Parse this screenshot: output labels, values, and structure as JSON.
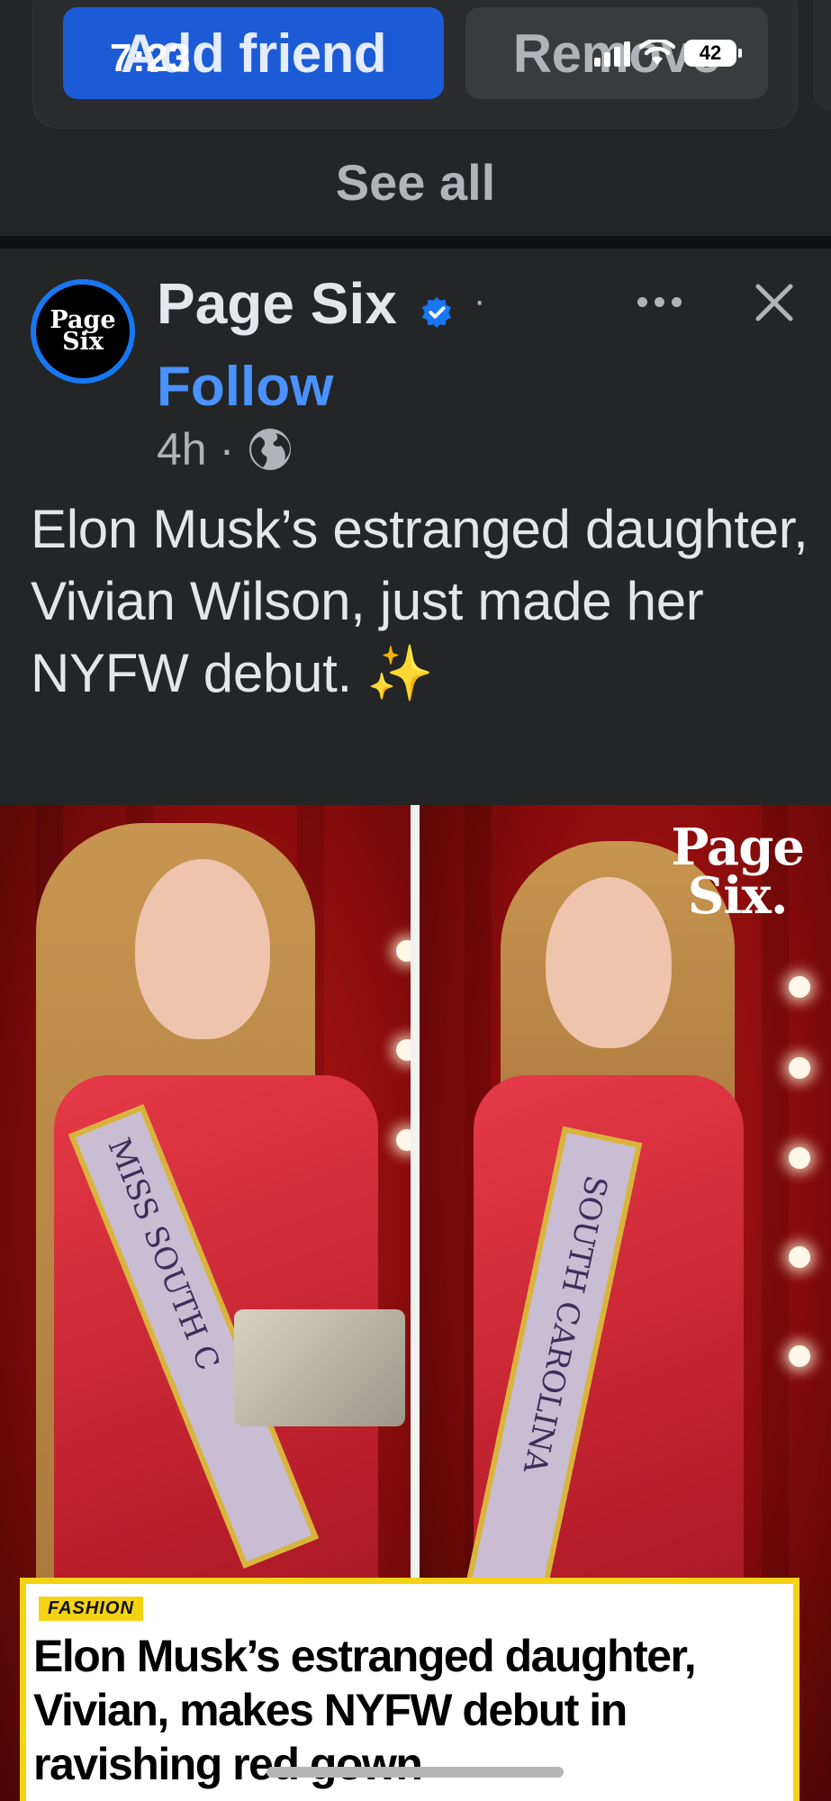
{
  "status_bar": {
    "time": "7:23",
    "battery": "42"
  },
  "suggestion_card": {
    "add_friend_label": "Add friend",
    "remove_label": "Remove",
    "see_all_label": "See all"
  },
  "post": {
    "page_name": "Page Six",
    "avatar_text_line1": "Page",
    "avatar_text_line2": "Six",
    "separator": "·",
    "follow_label": "Follow",
    "time_ago": "4h",
    "meta_separator": "·",
    "text": "Elon Musk’s estranged daughter, Vivian Wilson, just made her NYFW debut. ✨",
    "photo": {
      "watermark_line1": "Page",
      "watermark_line2": "Six.",
      "sash_left_text": "MISS SOUTH C",
      "sash_right_text": "SOUTH CAROLINA"
    },
    "link_card": {
      "tag": "FASHION",
      "headline": "Elon Musk’s estranged daughter, Vivian, makes NYFW debut in ravishing red gown"
    }
  },
  "colors": {
    "background": "#242526",
    "add_friend_button": "#1c5bd6",
    "follow_link": "#4a92ff",
    "verified_badge": "#1877f2",
    "fashion_tag": "#f5d313"
  },
  "icons": [
    "verified-badge-icon",
    "more-options-icon",
    "close-icon",
    "globe-icon",
    "wifi-icon",
    "signal-icon",
    "battery-icon"
  ]
}
